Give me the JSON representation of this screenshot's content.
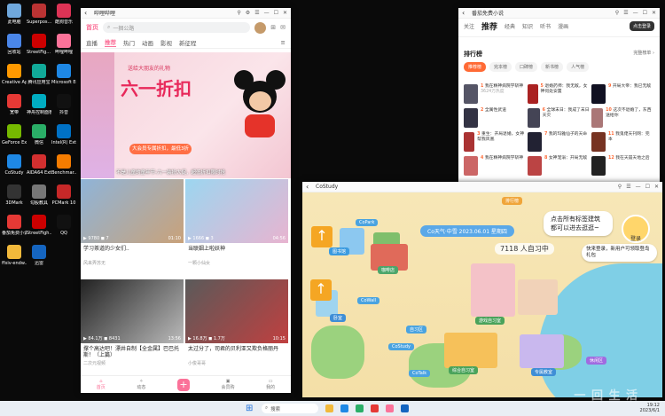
{
  "desktop": {
    "icons": [
      {
        "label": "此电脑",
        "color": "#6fa8dc"
      },
      {
        "label": "Superpos... Benchmark",
        "color": "#b33"
      },
      {
        "label": "酷狗音乐",
        "color": "#d35"
      },
      {
        "label": "回收站",
        "color": "#4a86e8"
      },
      {
        "label": "StreetFig... Benchmark",
        "color": "#c00"
      },
      {
        "label": "哔哩哔哩",
        "color": "#fb7299"
      },
      {
        "label": "Creative App",
        "color": "#f90"
      },
      {
        "label": "腾讯应用宝",
        "color": "#1a9"
      },
      {
        "label": "Microsoft Edge",
        "color": "#1e88e5"
      },
      {
        "label": "宽带",
        "color": "#e53935"
      },
      {
        "label": "神舟控制面板",
        "color": "#00acc1"
      },
      {
        "label": "抖音",
        "color": "#111"
      },
      {
        "label": "GeForce Experience",
        "color": "#76b900"
      },
      {
        "label": "微信",
        "color": "#2aae67"
      },
      {
        "label": "Intel(R) Extre...",
        "color": "#0071c5"
      },
      {
        "label": "CoStudy",
        "color": "#1e88e5"
      },
      {
        "label": "AIDA64 Extreme",
        "color": "#d32f2f"
      },
      {
        "label": "Benchmar...",
        "color": "#f57c00"
      },
      {
        "label": "3DMark",
        "color": "#333"
      },
      {
        "label": "勾股教具",
        "color": "#777"
      },
      {
        "label": "PCMark 10",
        "color": "#c62828"
      },
      {
        "label": "番茄免费小说",
        "color": "#e53935"
      },
      {
        "label": "StreetFigh...",
        "color": "#c00"
      },
      {
        "label": "QQ",
        "color": "#111"
      },
      {
        "label": "ffxiv-endw...",
        "color": "#f2b93b"
      },
      {
        "label": "迅雷",
        "color": "#1565c0"
      }
    ]
  },
  "bilibili": {
    "title": "哔哩哔哩",
    "logo": "首页",
    "search_placeholder": "一捆公路",
    "tabs": [
      "直播",
      "推荐",
      "热门",
      "动画",
      "影视",
      "新征程"
    ],
    "active_tab": "推荐",
    "banner": {
      "subtitle": "送给大朋友的礼物",
      "headline": "六一折扣",
      "tag": "大会员专属折扣，最低3折",
      "caption": "不是儿童的童年节-六一装扮大促，超低折扣限时抢"
    },
    "cards": [
      {
        "title": "学习茶道的少女们..",
        "up": "风来弄苏无",
        "stats": "▶ 9780  ◼ 7",
        "duration": "01:10",
        "color1": "#8fb4d8",
        "color2": "#c9a27a"
      },
      {
        "title": "当联姻上啦妖神",
        "up": "一颗小仙女",
        "stats": "▶ 1666  ◼ 3",
        "duration": "04:56",
        "color1": "#9cd6f0",
        "color2": "#e8b4d0"
      },
      {
        "title": "撑个高达吧！漂井自制【全金属】巴巴托斯！（上篇）",
        "up": "二次元视频",
        "stats": "▶ 84.1万  ◼ 8431",
        "duration": "13:56",
        "color1": "#222",
        "color2": "#bbb"
      },
      {
        "title": "太过分了，司君的贝利亚又欺负格丽丹",
        "up": "小俊哥哥",
        "stats": "▶ 16.8万  ◼ 1.7万",
        "duration": "10:15",
        "color1": "#5a5a5a",
        "color2": "#c04040"
      }
    ],
    "nav": [
      "首页",
      "动态",
      "",
      "会员购",
      "我的"
    ]
  },
  "novel": {
    "title": "番茄免费小说",
    "tabs": [
      "关注",
      "推荐",
      "经典",
      "知识",
      "听书",
      "漫画"
    ],
    "active_tab": "推荐",
    "login_label": "点击登录",
    "rank_title": "排行榜",
    "rank_more": "完整榜单 ›",
    "chips": [
      "推荐榜",
      "完本榜",
      "口碑榜",
      "新书榜",
      "人气榜"
    ],
    "items": [
      {
        "num": "1",
        "title": "我在精神病院学斩神",
        "sub": "3624万热度",
        "color": "#556"
      },
      {
        "num": "2",
        "title": "全属性武道",
        "sub": "",
        "color": "#334"
      },
      {
        "num": "3",
        "title": "重生：开局退婚，女神帮我凤凰",
        "sub": "",
        "color": "#a33"
      },
      {
        "num": "4",
        "title": "我在精神病院学斩神",
        "sub": "",
        "color": "#c66"
      },
      {
        "num": "5",
        "title": "退婚药师：我无敌，女神何处安置",
        "sub": "",
        "color": "#a22"
      },
      {
        "num": "6",
        "title": "全球末日：我成了末日天灾",
        "sub": "",
        "color": "#445"
      },
      {
        "num": "7",
        "title": "我的玛雅仙子的天命",
        "sub": "",
        "color": "#223"
      },
      {
        "num": "8",
        "title": "女神宠溺：开局无敌",
        "sub": "",
        "color": "#b44"
      },
      {
        "num": "9",
        "title": "开局大帝：我已无敌",
        "sub": "",
        "color": "#112"
      },
      {
        "num": "10",
        "title": "这次不退婚了，东西送给你",
        "sub": "",
        "color": "#a77"
      },
      {
        "num": "11",
        "title": "我鬼佬天刊网：完本",
        "sub": "",
        "color": "#732"
      },
      {
        "num": "12",
        "title": "我在天崩天地之后",
        "sub": "",
        "color": "#222"
      }
    ]
  },
  "costudy": {
    "title": "CoStudy",
    "weather": "Co天气·中雪  2023.06.01 星期四",
    "count": "7118 人自习中",
    "hint": "点击所有标签建筑 都可以进去逛逛~",
    "hint2": "快来登录，新用户可领取登岛礼包",
    "login": "登录",
    "rank_badge": "排行榜",
    "labels": [
      {
        "text": "CoPark",
        "color": "#4aa3e0"
      },
      {
        "text": "图书馆",
        "color": "#3b9be0"
      },
      {
        "text": "咖啡店",
        "color": "#4ca66b"
      },
      {
        "text": "CoWall",
        "color": "#4aa3e0"
      },
      {
        "text": "卧室",
        "color": "#3f8ed6"
      },
      {
        "text": "游戏自习室",
        "color": "#4aa35b"
      },
      {
        "text": "自习区",
        "color": "#4aa3e0"
      },
      {
        "text": "CoStudy",
        "color": "#4aa3e0"
      },
      {
        "text": "综合自习室",
        "color": "#4aa35b"
      },
      {
        "text": "CoTalk",
        "color": "#4aa3e0"
      },
      {
        "text": "专属教室",
        "color": "#3f8ed6"
      },
      {
        "text": "休闲区",
        "color": "#a06be0"
      }
    ]
  },
  "taskbar": {
    "search": "搜索",
    "time": "19:12",
    "date": "2023/6/1"
  },
  "watermark": "一 回 生 活"
}
